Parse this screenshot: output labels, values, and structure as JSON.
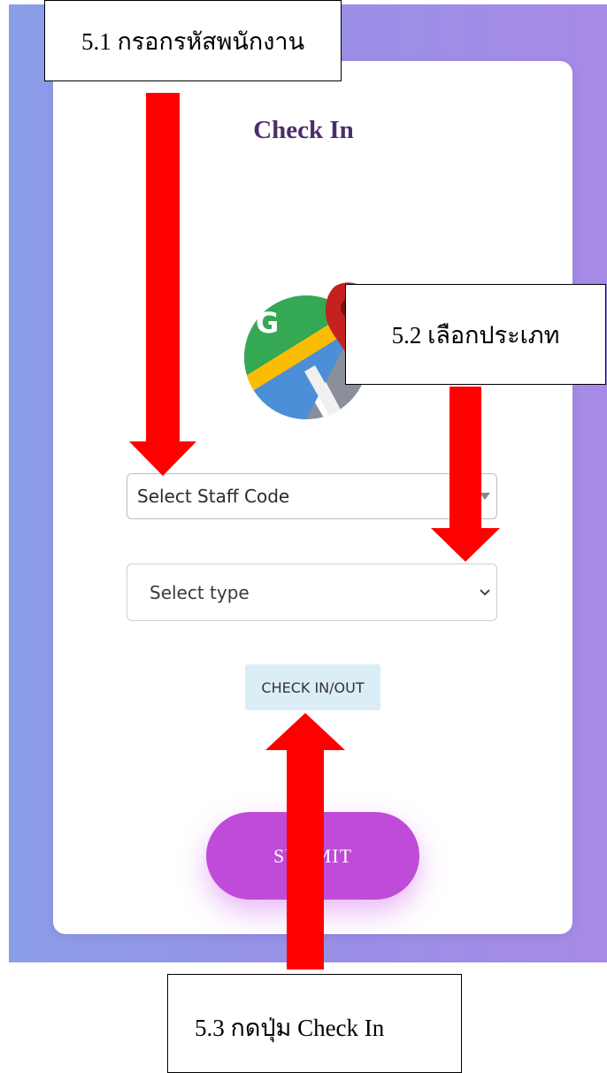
{
  "screen": {
    "title": "Check In"
  },
  "form": {
    "staff_select": {
      "value": "Select Staff Code"
    },
    "type_select": {
      "value": "Select type"
    },
    "checkin_button_label": "CHECK IN/OUT",
    "submit_button_label": "SUBMIT"
  },
  "annotations": {
    "step_1": "5.1 กรอกรหัสพนักงาน",
    "step_2": "5.2 เลือกประเภท",
    "step_3": "5.3 กดปุ่ม Check In"
  },
  "icons": {
    "logo": "google-maps-icon",
    "dropdown": "chevron-down-icon",
    "annotation_arrow": "arrow-icon"
  },
  "colors": {
    "background_left": "#8b9ee8",
    "background_right": "#a68ae6",
    "title": "#4c2d6b",
    "checkin_button": "#dbeef7",
    "submit_button": "#c04bd8",
    "annotation_arrow": "#ff0000"
  }
}
